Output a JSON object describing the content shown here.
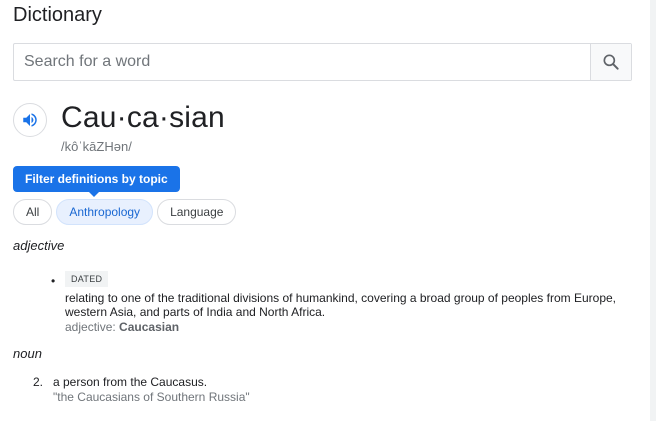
{
  "header": {
    "title": "Dictionary"
  },
  "search": {
    "placeholder": "Search for a word",
    "value": ""
  },
  "entry": {
    "headword": "Cau·ca·sian",
    "phonetic": "/kôˈkāZHən/"
  },
  "filter": {
    "tooltip": "Filter definitions by topic",
    "chips": [
      {
        "label": "All",
        "active": false
      },
      {
        "label": "Anthropology",
        "active": true
      },
      {
        "label": "Language",
        "active": false
      }
    ]
  },
  "senses": {
    "adjective": {
      "pos": "adjective",
      "tag": "DATED",
      "definition": "relating to one of the traditional divisions of humankind, covering a broad group of peoples from Europe, western Asia, and parts of India and North Africa.",
      "related_prefix": "adjective:",
      "related_word": "Caucasian"
    },
    "noun": {
      "pos": "noun",
      "number": "2.",
      "definition": "a person from the Caucasus.",
      "example": "\"the Caucasians of Southern Russia\""
    }
  },
  "colors": {
    "accent": "#1a73e8",
    "chip_active_bg": "#e8f0fe"
  },
  "icons": {
    "search": "search-icon",
    "speaker": "speaker-icon"
  }
}
